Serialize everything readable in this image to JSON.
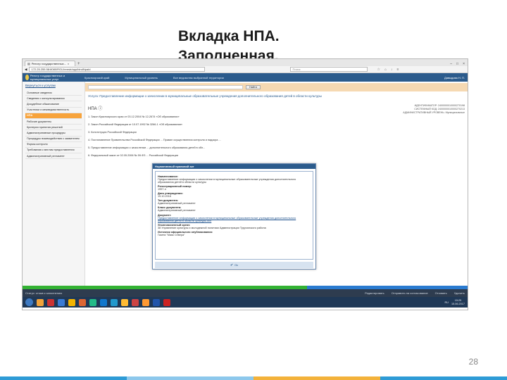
{
  "slide": {
    "title": "Вкладка НПА. Заполненная.",
    "page_number": "28",
    "bottom_bar_colors": [
      "#2e9bd6",
      "#8dc8ec",
      "#f3b23a",
      "#2e9bd6"
    ]
  },
  "browser": {
    "tab_title": "Реестр государственных...",
    "url": "172.25.255.58:8080/RGU/reestr/app/bindNpaId",
    "search_placeholder": "Поиск"
  },
  "portal": {
    "logo_text": "Реестр государственных и муниципальных услуг",
    "nav": [
      "Красноярский край",
      "Муниципальный уровень",
      "Все ведомства выбранной территории"
    ],
    "user": "Давыдова Н. П."
  },
  "sidebar": {
    "back_link": "Вернуться к услугам",
    "items": [
      {
        "label": "Основные сведения",
        "active": false
      },
      {
        "label": "Сведения о консультировании",
        "active": false
      },
      {
        "label": "Досудебное обжалование",
        "active": false
      },
      {
        "label": "Участники и межведомственность",
        "active": false
      },
      {
        "label": "НПА",
        "active": true
      },
      {
        "label": "Рабочие документы",
        "active": false
      },
      {
        "label": "Критерии принятия решений",
        "active": false
      },
      {
        "label": "Административные процедуры",
        "active": false
      },
      {
        "label": "Процедуры взаимодействия с заявителем",
        "active": false
      },
      {
        "label": "Формы контроля",
        "active": false
      },
      {
        "label": "Требования к местам предоставления",
        "active": false
      },
      {
        "label": "Административный регламент",
        "active": false
      }
    ]
  },
  "main": {
    "find_button": "Найти",
    "service_title": "Услуга: Предоставление информации о зачислении в муниципальные образовательные учреждения дополнительного образования детей в области культуры",
    "heading": "НПА",
    "ids": [
      "ИДЕНТИФИКАТОР: 2400000010000270198",
      "СИСТЕМНЫЙ КОД: 2400000010000270213",
      "АДМИНИСТРАТИВНЫЙ УРОВЕНЬ: Муниципальные"
    ],
    "npa_items": [
      "1. Закон Красноярского края от 03.12.2004 № 12-2674 «Об образовании»",
      "2. Закон Российской Федерации от 10.07.1992 № 3266-1 «Об образовании»",
      "3. Конституция Российской Федерации",
      "4. Постановление Правительства Российской Федерации ... Правил осуществления контроля и надзора ...",
      "5. Предоставление информации о зачислении ... дополнительного образования детей в обл...",
      "6. Федеральный закон от 02.05.2006 № 59-ФЗ ... Российской Федерации"
    ]
  },
  "modal": {
    "title": "Нормативный правовой акт",
    "fields": [
      {
        "label": "Наименование:",
        "value": "Предоставление информации о зачислении в муниципальные образовательные учреждения дополнительного образования детей в области культуры",
        "link": false
      },
      {
        "label": "Регистрационный номер:",
        "value": "1957-п",
        "link": false
      },
      {
        "label": "Дата утверждения:",
        "value": "19.10.2016",
        "link": false
      },
      {
        "label": "Тип документа:",
        "value": "Административный регламент",
        "link": false
      },
      {
        "label": "Класс документа:",
        "value": "Административный регламент",
        "link": false
      },
      {
        "label": "Документ:",
        "value": "Предоставление информации о зачислении в муниципальные образовательные учреждения дополнительного образования детей в области культуры.doc",
        "link": true
      },
      {
        "label": "Уполномоченный орган:",
        "value": "38 Управление культуры и молодежной политики Администрации Туруханского района",
        "link": false
      },
      {
        "label": "Источник официального опубликования:",
        "value": "Газета \"Маяк Севера\"",
        "link": false
      }
    ],
    "ok_label": "Ок"
  },
  "status_bar": {
    "left": "Статус: отзыв к заполнению",
    "right": [
      "Редактировать",
      "Отправить на согласование",
      "Отозвать",
      "Удалить"
    ]
  },
  "taskbar": {
    "lang": "RU",
    "time": "15:25",
    "date": "15.06.2017",
    "app_colors": [
      "#f2a33a",
      "#c33",
      "#3a7bd5",
      "#f4b400",
      "#d63",
      "#2b8",
      "#17c",
      "#29c",
      "#fb3",
      "#c44",
      "#f93",
      "#25a",
      "#c22"
    ]
  },
  "progress": {
    "fraction": 0.64
  }
}
